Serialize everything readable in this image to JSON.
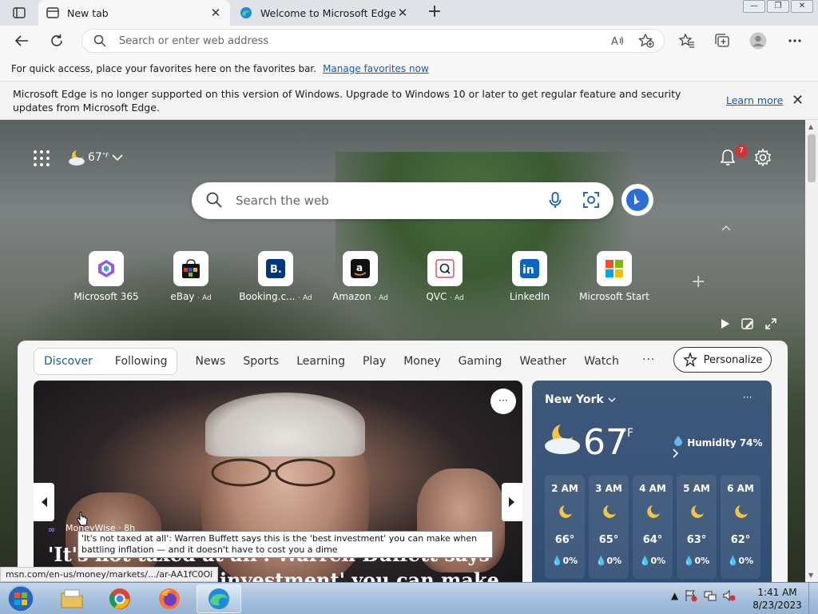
{
  "tabs": [
    {
      "title": "New tab",
      "close": "✕",
      "active": true
    },
    {
      "title": "Welcome to Microsoft Edge",
      "close": "✕",
      "active": false
    }
  ],
  "newtab_symbol": "+",
  "window_controls": {
    "minimize": "—",
    "restore": "❐",
    "close": "✕"
  },
  "address": {
    "placeholder": "Search or enter web address"
  },
  "favbar": {
    "text": "For quick access, place your favorites here on the favorites bar.",
    "link": "Manage favorites now"
  },
  "infobar": {
    "message": "Microsoft Edge is no longer supported on this version of Windows. Upgrade to Windows 10 or later to get regular feature and security updates from Microsoft Edge.",
    "learn_more": "Learn more",
    "close": "✕"
  },
  "ntp": {
    "weather_temp": "67",
    "weather_unit": "°F",
    "notifications": "7",
    "search_placeholder": "Search the web",
    "quicklinks": [
      {
        "label": "Microsoft 365",
        "ad": ""
      },
      {
        "label": "eBay",
        "ad": "· Ad"
      },
      {
        "label": "Booking.c...",
        "ad": "· Ad"
      },
      {
        "label": "Amazon",
        "ad": "· Ad"
      },
      {
        "label": "QVC",
        "ad": "· Ad"
      },
      {
        "label": "LinkedIn",
        "ad": ""
      },
      {
        "label": "Microsoft Start",
        "ad": ""
      }
    ],
    "add_link": "+"
  },
  "feed": {
    "seg_discover": "Discover",
    "seg_following": "Following",
    "nav": [
      "News",
      "Sports",
      "Learning",
      "Play",
      "Money",
      "Gaming",
      "Weather",
      "Watch"
    ],
    "more": "···",
    "personalize": "Personalize",
    "hero": {
      "source": "MoneyWise · 8h",
      "headline": "'It's not taxed at all': Warren Buffett says this is the 'best investment' you can make when battling",
      "dots": "···"
    },
    "weather": {
      "city": "New York",
      "temp": "67",
      "unit": "°F",
      "humidity": "Humidity 74%",
      "dots": "···",
      "hours": [
        {
          "time": "2 AM",
          "temp": "66°",
          "precip": "0%"
        },
        {
          "time": "3 AM",
          "temp": "65°",
          "precip": "0%"
        },
        {
          "time": "4 AM",
          "temp": "64°",
          "precip": "0%"
        },
        {
          "time": "5 AM",
          "temp": "63°",
          "precip": "0%"
        },
        {
          "time": "6 AM",
          "temp": "62°",
          "precip": "0%"
        }
      ]
    }
  },
  "tooltip": "'It's not taxed at all': Warren Buffett says this is the 'best investment' you can make when battling inflation — and it doesn't have to cost you a dime",
  "status_url": "msn.com/en-us/money/markets/.../ar-AA1fC0Oi",
  "taskbar": {
    "time": "1:41 AM",
    "date": "8/23/2023"
  },
  "colors": {
    "accent": "#0f5bb5",
    "badge": "#d13438"
  }
}
